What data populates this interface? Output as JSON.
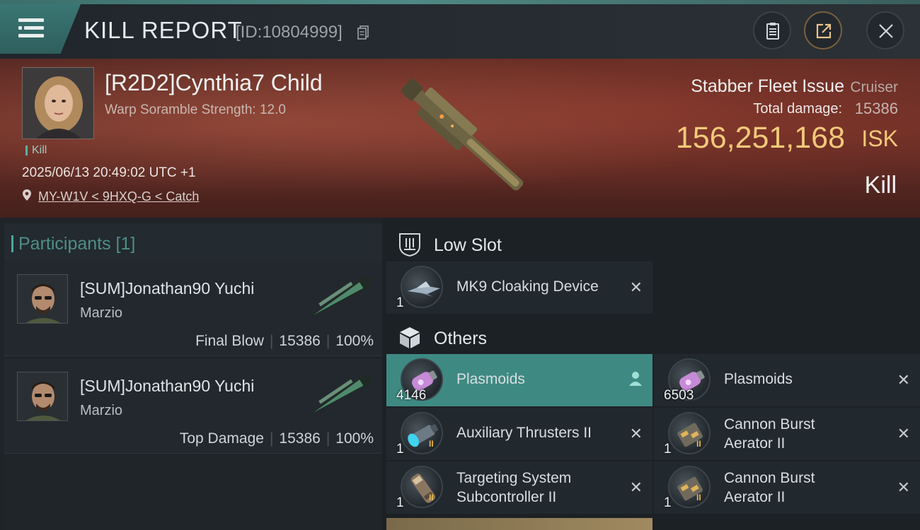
{
  "header": {
    "title": "KILL REPORT",
    "report_id": "[ID:10804999]"
  },
  "victim": {
    "pilot_name": "[R2D2]Cynthia7 Child",
    "warp_scramble": "Warp Soramble Strength: 12.0",
    "tag": "Kill",
    "datetime": "2025/06/13 20:49:02 UTC +1",
    "location": "MY-W1V < 9HXQ-G < Catch",
    "ship_name": "Stabber Fleet Issue",
    "ship_class": "Cruiser",
    "total_damage_label": "Total damage:",
    "total_damage": "15386",
    "isk_value": "156,251,168",
    "isk_unit": "ISK",
    "result": "Kill"
  },
  "participants": {
    "header": "Participants [1]",
    "rows": [
      {
        "name": "[SUM]Jonathan90 Yuchi",
        "corp": "Marzio",
        "role": "Final Blow",
        "damage": "15386",
        "percent": "100%"
      },
      {
        "name": "[SUM]Jonathan90 Yuchi",
        "corp": "Marzio",
        "role": "Top Damage",
        "damage": "15386",
        "percent": "100%"
      }
    ]
  },
  "sections": {
    "low_slot": {
      "label": "Low Slot",
      "items": [
        {
          "name": "MK9 Cloaking Device",
          "qty": "1",
          "icon": "cloak-icon"
        }
      ]
    },
    "others": {
      "label": "Others",
      "items": [
        {
          "name": "Plasmoids",
          "qty": "4146",
          "icon": "plasmoid-icon",
          "selected": true
        },
        {
          "name": "Plasmoids",
          "qty": "6503",
          "icon": "plasmoid-icon"
        },
        {
          "name": "Auxiliary Thrusters II",
          "qty": "1",
          "icon": "thruster-icon",
          "tier": "II"
        },
        {
          "name_line1": "Cannon Burst",
          "name_line2": "Aerator II",
          "qty": "1",
          "icon": "cannon-aerator-icon",
          "tier": "II"
        },
        {
          "name_line1": "Targeting System",
          "name_line2": "Subcontroller II",
          "qty": "1",
          "icon": "targeting-icon",
          "tier": "II"
        },
        {
          "name_line1": "Cannon Burst",
          "name_line2": "Aerator II",
          "qty": "1",
          "icon": "cannon-aerator-icon",
          "tier": "II"
        }
      ]
    }
  },
  "colors": {
    "accent_teal": "#3e8a83",
    "isk_gold": "#f2c97a",
    "banner_red": "#6c2f27"
  }
}
